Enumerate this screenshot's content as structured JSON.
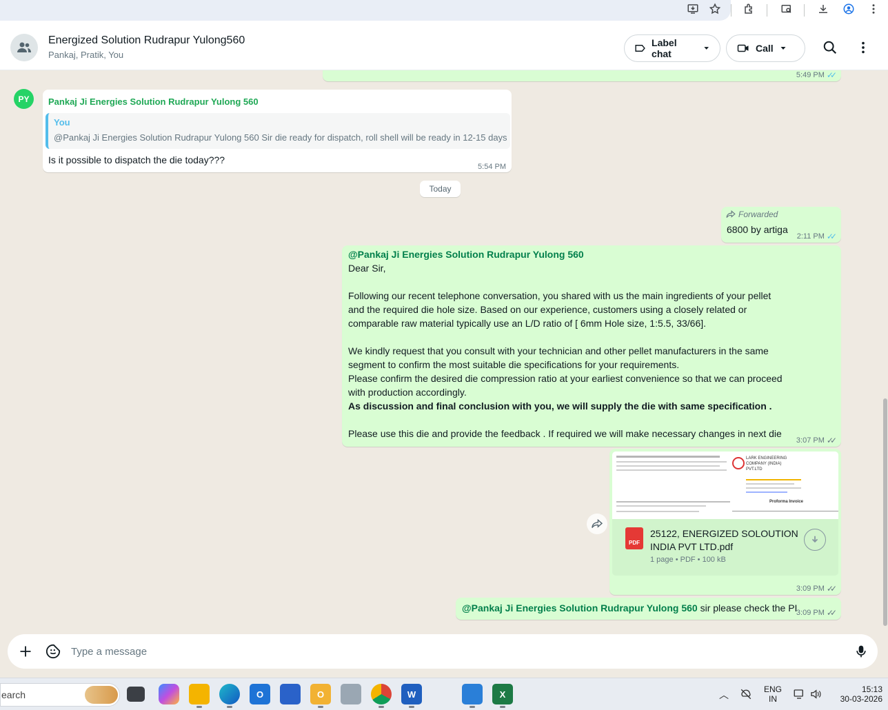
{
  "browser": {
    "icons": [
      "install-icon",
      "star-icon",
      "extensions-icon",
      "tab-search-icon",
      "download-icon",
      "profile-icon",
      "more-vert-icon"
    ]
  },
  "header": {
    "title": "Energized Solution Rudrapur Yulong560",
    "subtitle": "Pankaj, Pratik, You",
    "label_chat": "Label chat",
    "call": "Call"
  },
  "messages": {
    "prev_time": "5:49 PM",
    "incoming": {
      "avatar_initials": "PY",
      "sender": "Pankaj Ji Energies Solution Rudrapur Yulong 560",
      "quote_author": "You",
      "quote_text": "@Pankaj Ji Energies Solution Rudrapur Yulong 560 Sir die ready for dispatch, roll shell will be ready in 12-15 days",
      "text": "Is it possible to dispatch the die today???",
      "time": "5:54 PM"
    },
    "date_divider": "Today",
    "forwarded": {
      "label": "Forwarded",
      "text": "6800 by artiga",
      "time": "2:11 PM"
    },
    "long_message": {
      "mention": "@Pankaj Ji Energies Solution Rudrapur Yulong 560",
      "greeting": "Dear Sir,",
      "p1_line1": "Following our recent telephone conversation, you  shared with us the main ingredients of your pellet",
      "p1_line2": "and the required die hole size. Based on our experience, customers using a closely related or",
      "p1_line3": "comparable raw material typically use an L/D ratio of [  6mm Hole size, 1:5.5, 33/66].",
      "p2_line1": "We kindly request that you consult with your technician  and other pellet manufacturers in the same",
      "p2_line2": "segment to confirm the most suitable die specifications for your requirements.",
      "p2_line3": "Please confirm the desired die compression ratio at your earliest convenience so that we can proceed",
      "p2_line4": "with production accordingly.",
      "bold_line": "As discussion and final conclusion with you, we will supply the die with same specification .",
      "p3": "Please use this die and provide the feedback . If required we will make necessary changes in next die",
      "time": "3:07 PM"
    },
    "document": {
      "preview_company": "LARK ENGINEERING COMPANY (INDIA) PVT.LTD",
      "preview_title": "Proforma Invoice",
      "file_badge": "PDF",
      "file_name_line1": "25122, ENERGIZED SOLOUTION",
      "file_name_line2": "INDIA PVT LTD.pdf",
      "file_meta": "1 page • PDF • 100 kB",
      "time": "3:09 PM"
    },
    "last": {
      "mention": "@Pankaj Ji Energies Solution Rudrapur Yulong 560",
      "text": " sir please check the PI",
      "time": "3:09 PM"
    }
  },
  "composer": {
    "placeholder": "Type a message"
  },
  "taskbar": {
    "search_text": "earch",
    "apps": [
      "task-view",
      "copilot",
      "file-explorer",
      "edge",
      "outlook",
      "store",
      "mail",
      "files",
      "chrome",
      "word",
      "photos",
      "excel"
    ],
    "lang_line1": "ENG",
    "lang_line2": "IN",
    "time": "15:13",
    "date": "30-03-2026"
  },
  "colors": {
    "accent_green": "#008069",
    "outgoing_bubble": "#d9fdd3",
    "read_tick": "#53bdeb",
    "mention_green": "#027f4b"
  }
}
